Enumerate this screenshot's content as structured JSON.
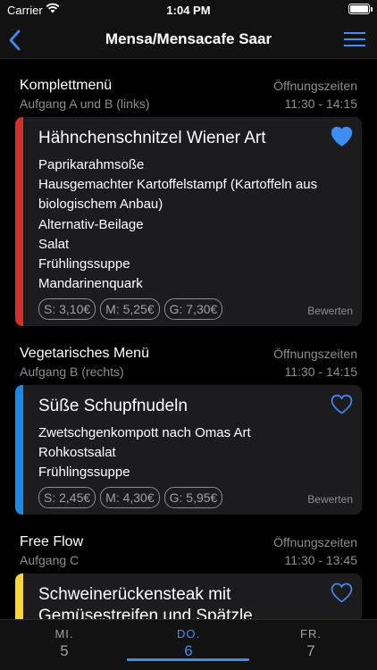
{
  "status": {
    "carrier": "Carrier",
    "time": "1:04 PM"
  },
  "nav": {
    "title": "Mensa/Mensacafe Saar"
  },
  "sections": [
    {
      "title": "Komplettmenü",
      "subtitle": "Aufgang A und B (links)",
      "hours_label": "Öffnungszeiten",
      "hours": "11:30 - 14:15",
      "dish": "Hähnchenschnitzel Wiener Art",
      "stripe_color": "#d32f2f",
      "favorite": true,
      "sides": [
        "Paprikarahmsoße",
        "Hausgemachter Kartoffelstampf (Kartoffeln aus biologischem Anbau)",
        "Alternativ-Beilage",
        "Salat",
        "Frühlingssuppe",
        "Mandarinenquark"
      ],
      "prices": [
        "S: 3,10€",
        "M: 5,25€",
        "G: 7,30€"
      ],
      "rate": "Bewerten"
    },
    {
      "title": "Vegetarisches Menü",
      "subtitle": "Aufgang B (rechts)",
      "hours_label": "Öffnungszeiten",
      "hours": "11:30 - 14:15",
      "dish": "Süße Schupfnudeln",
      "stripe_color": "#1e88e5",
      "favorite": false,
      "sides": [
        "Zwetschgenkompott nach Omas Art",
        "Rohkostsalat",
        "Frühlingssuppe"
      ],
      "prices": [
        "S: 2,45€",
        "M: 4,30€",
        "G: 5,95€"
      ],
      "rate": "Bewerten"
    },
    {
      "title": "Free Flow",
      "subtitle": "Aufgang C",
      "hours_label": "Öffnungszeiten",
      "hours": "11:30 - 13:45",
      "dish": "Schweinerückensteak mit Gemüsestreifen und Spätzle",
      "stripe_color": "#fdd835",
      "favorite": false
    }
  ],
  "tabs": [
    {
      "day": "MI.",
      "num": "5"
    },
    {
      "day": "DO.",
      "num": "6"
    },
    {
      "day": "FR.",
      "num": "7"
    }
  ],
  "accent": "#3e8ef7"
}
